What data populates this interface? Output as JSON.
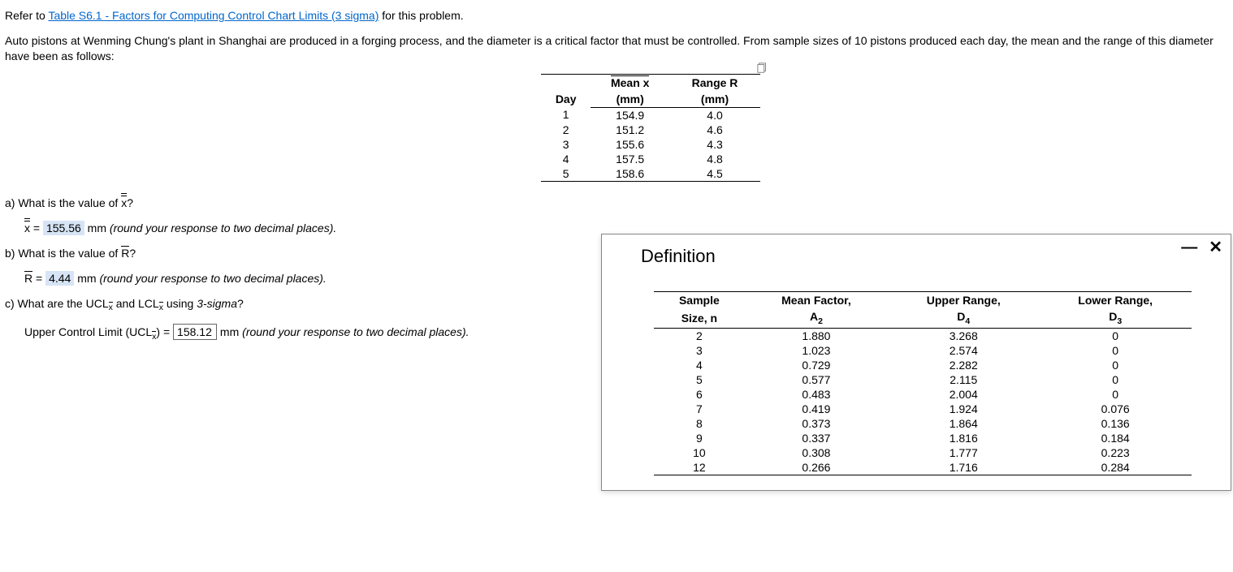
{
  "intro": {
    "refer_prefix": "Refer to ",
    "link_text": "Table S6.1 - Factors for Computing Control Chart Limits (3 sigma)",
    "refer_suffix": " for this problem.",
    "problem_text": "Auto pistons at Wenming Chung's plant in Shanghai are produced in a forging process, and the diameter is a critical factor that must be controlled. From sample sizes of 10 pistons produced each day, the mean and the range of this diameter have been as follows:"
  },
  "data_table": {
    "headers": {
      "day": "Day",
      "mean_top": "Mean x̄",
      "mean_bot": "(mm)",
      "range_top": "Range R",
      "range_bot": "(mm)"
    },
    "rows": [
      {
        "day": "1",
        "mean": "154.9",
        "range": "4.0"
      },
      {
        "day": "2",
        "mean": "151.2",
        "range": "4.6"
      },
      {
        "day": "3",
        "mean": "155.6",
        "range": "4.3"
      },
      {
        "day": "4",
        "mean": "157.5",
        "range": "4.8"
      },
      {
        "day": "5",
        "mean": "158.6",
        "range": "4.5"
      }
    ]
  },
  "questions": {
    "a": {
      "prompt_pre": "a) What is the value of ",
      "prompt_sym": "x",
      "prompt_post": "?",
      "ans_pre": "x",
      "ans_eq": " = ",
      "ans_val": "155.56",
      "ans_unit": " mm ",
      "hint": "(round your response to two decimal places)."
    },
    "b": {
      "prompt_pre": "b) What is the value of ",
      "prompt_sym": "R",
      "prompt_post": "?",
      "ans_pre": "R",
      "ans_eq": " = ",
      "ans_val": "4.44",
      "ans_unit": " mm ",
      "hint": "(round your response to two decimal places)."
    },
    "c": {
      "prompt": "c) What are the UCL− and LCL− using 3-sigma?",
      "prompt_pre": "c) What are the UCL",
      "prompt_mid": " and LCL",
      "prompt_post": " using ",
      "prompt_sigma": "3-sigma",
      "prompt_q": "?",
      "ans_label_pre": "Upper Control Limit (UCL",
      "ans_label_post": ") = ",
      "ans_val": "158.12",
      "ans_unit": " mm ",
      "hint": "(round your response to two decimal places)."
    },
    "sub_x": "x̄"
  },
  "popup": {
    "title": "Definition",
    "headers": {
      "n_top": "Sample",
      "n_bot": "Size, n",
      "a2_top": "Mean Factor,",
      "a2_bot": "A₂",
      "d4_top": "Upper Range,",
      "d4_bot": "D₄",
      "d3_top": "Lower Range,",
      "d3_bot": "D₃"
    },
    "rows": [
      {
        "n": "2",
        "a2": "1.880",
        "d4": "3.268",
        "d3": "0"
      },
      {
        "n": "3",
        "a2": "1.023",
        "d4": "2.574",
        "d3": "0"
      },
      {
        "n": "4",
        "a2": "0.729",
        "d4": "2.282",
        "d3": "0"
      },
      {
        "n": "5",
        "a2": "0.577",
        "d4": "2.115",
        "d3": "0"
      },
      {
        "n": "6",
        "a2": "0.483",
        "d4": "2.004",
        "d3": "0"
      },
      {
        "n": "7",
        "a2": "0.419",
        "d4": "1.924",
        "d3": "0.076"
      },
      {
        "n": "8",
        "a2": "0.373",
        "d4": "1.864",
        "d3": "0.136"
      },
      {
        "n": "9",
        "a2": "0.337",
        "d4": "1.816",
        "d3": "0.184"
      },
      {
        "n": "10",
        "a2": "0.308",
        "d4": "1.777",
        "d3": "0.223"
      },
      {
        "n": "12",
        "a2": "0.266",
        "d4": "1.716",
        "d3": "0.284"
      }
    ]
  },
  "chart_data": {
    "type": "table",
    "title": "Factors for Computing Control Chart Limits (3 sigma)",
    "columns": [
      "Sample Size n",
      "Mean Factor A2",
      "Upper Range D4",
      "Lower Range D3"
    ],
    "rows": [
      [
        2,
        1.88,
        3.268,
        0
      ],
      [
        3,
        1.023,
        2.574,
        0
      ],
      [
        4,
        0.729,
        2.282,
        0
      ],
      [
        5,
        0.577,
        2.115,
        0
      ],
      [
        6,
        0.483,
        2.004,
        0
      ],
      [
        7,
        0.419,
        1.924,
        0.076
      ],
      [
        8,
        0.373,
        1.864,
        0.136
      ],
      [
        9,
        0.337,
        1.816,
        0.184
      ],
      [
        10,
        0.308,
        1.777,
        0.223
      ],
      [
        12,
        0.266,
        1.716,
        0.284
      ]
    ]
  }
}
